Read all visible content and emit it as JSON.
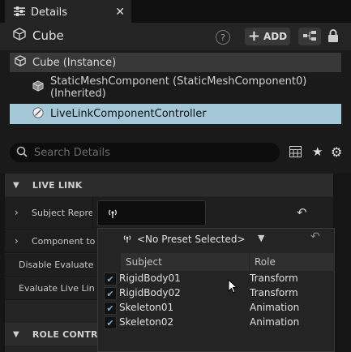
{
  "tab": {
    "title": "Details",
    "close": "✕"
  },
  "header": {
    "object_name": "Cube",
    "help": "?",
    "add_label": "ADD"
  },
  "tree": {
    "items": [
      {
        "label": "Cube (Instance)"
      },
      {
        "label": "StaticMeshComponent (StaticMeshComponent0) (Inherited)"
      },
      {
        "label": "LiveLinkComponentController"
      }
    ]
  },
  "search": {
    "placeholder": "Search Details"
  },
  "sections": {
    "live_link": "LIVE LINK",
    "role_controller": "ROLE CONTROLL"
  },
  "properties": [
    {
      "label": "Subject Repre"
    },
    {
      "label": "Component to"
    },
    {
      "label": "Disable Evaluate"
    },
    {
      "label": "Evaluate Live Lin"
    }
  ],
  "popup": {
    "preset_label": "<No Preset Selected>",
    "columns": {
      "subject": "Subject",
      "role": "Role"
    },
    "rows": [
      {
        "subject": "RigidBody01",
        "role": "Transform"
      },
      {
        "subject": "RigidBody02",
        "role": "Transform"
      },
      {
        "subject": "Skeleton01",
        "role": "Animation"
      },
      {
        "subject": "Skeleton02",
        "role": "Animation"
      }
    ]
  },
  "colors": {
    "selected_row": "#a4c8d8",
    "accent": "#7fa8c8"
  }
}
